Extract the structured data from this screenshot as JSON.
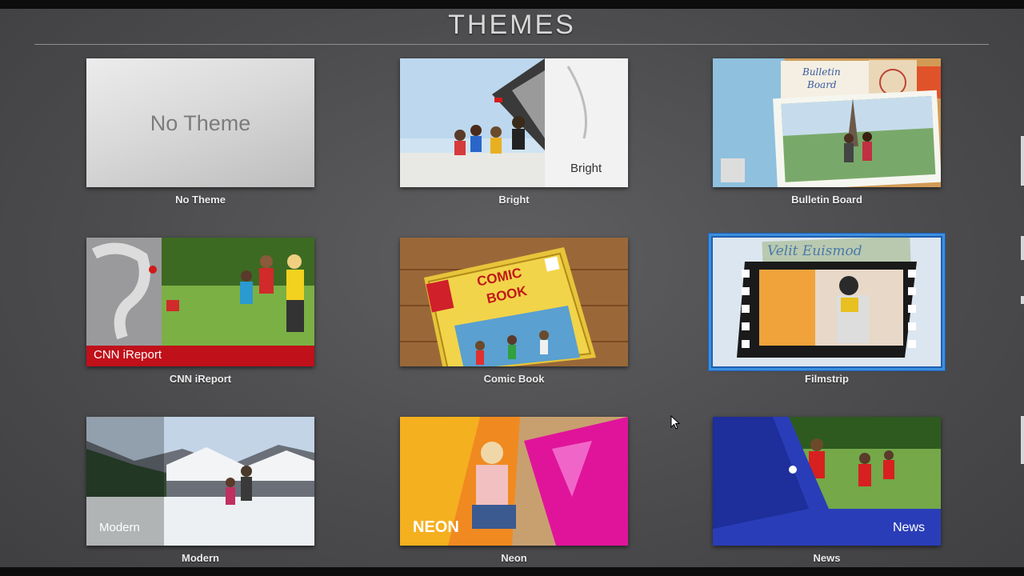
{
  "header": {
    "title": "THEMES"
  },
  "themes": {
    "no_theme": {
      "name": "No Theme",
      "preview_text": "No Theme"
    },
    "bright": {
      "name": "Bright",
      "preview_text": "Bright"
    },
    "bulletin": {
      "name": "Bulletin Board",
      "preview_text_line1": "Bulletin",
      "preview_text_line2": "Board"
    },
    "cnn": {
      "name": "CNN iReport",
      "preview_text": "CNN iReport"
    },
    "comic": {
      "name": "Comic Book",
      "preview_text_line1": "COMIC",
      "preview_text_line2": "BOOK"
    },
    "filmstrip": {
      "name": "Filmstrip",
      "preview_text": "Velit Euismod",
      "selected": true
    },
    "modern": {
      "name": "Modern",
      "preview_text": "Modern"
    },
    "neon": {
      "name": "Neon",
      "preview_text": "NEON"
    },
    "news": {
      "name": "News",
      "preview_text": "News"
    }
  },
  "colors": {
    "selection": "#3d8fe0",
    "cnn_red": "#c0101a",
    "neon_pink": "#e0149a",
    "news_blue": "#2a3db8"
  }
}
